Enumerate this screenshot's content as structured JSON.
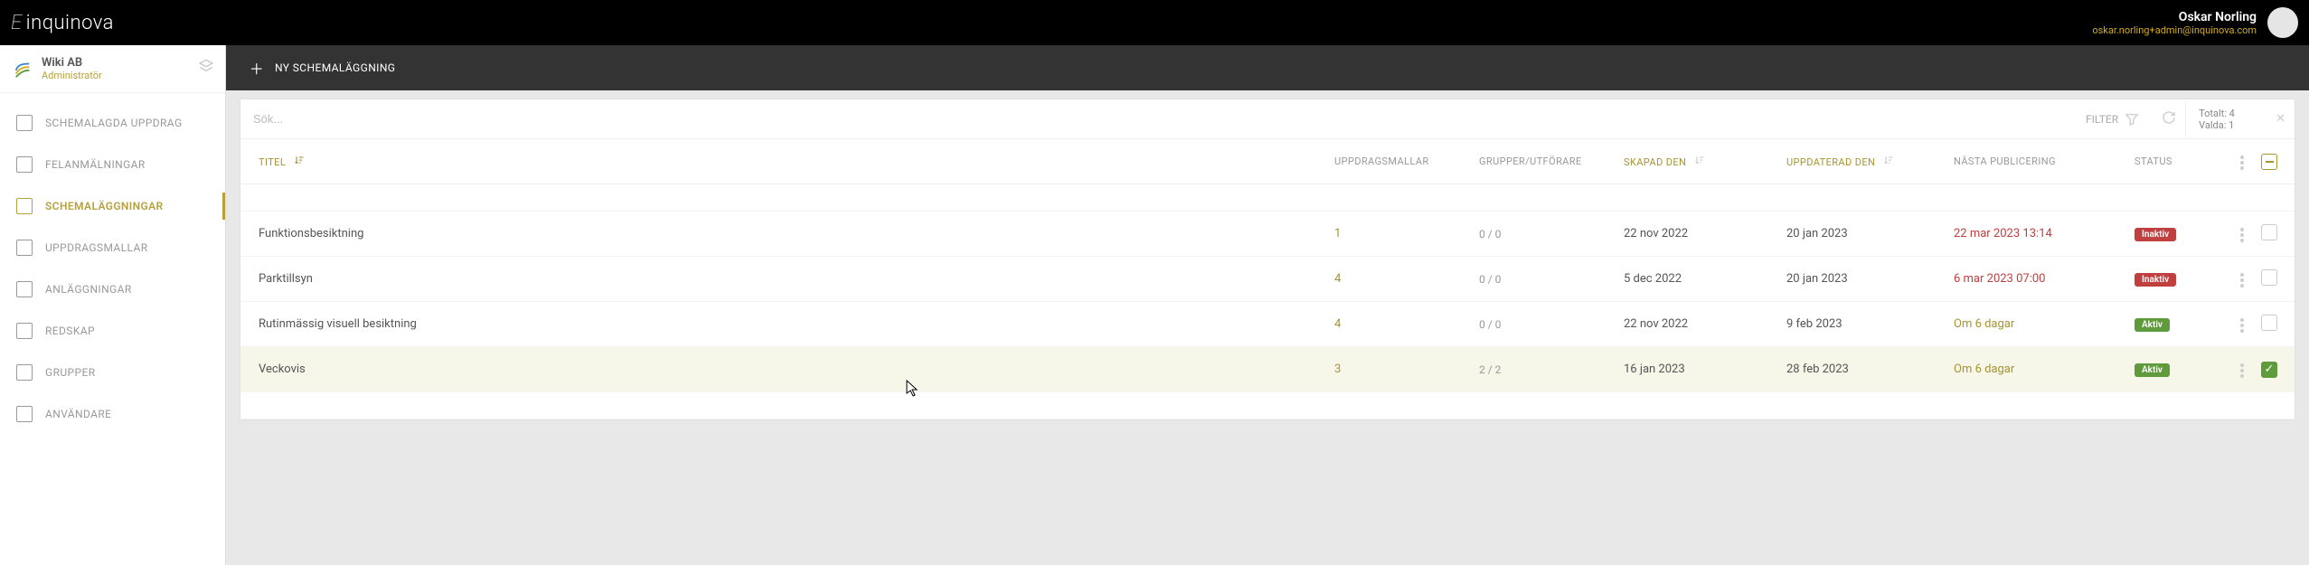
{
  "brand": {
    "prefix": "E",
    "name": "inquinova"
  },
  "user": {
    "name": "Oskar Norling",
    "email": "oskar.norling+admin@inquinova.com"
  },
  "org": {
    "name": "Wiki AB",
    "role": "Administratör"
  },
  "nav": {
    "items": [
      {
        "label": "SCHEMALAGDA UPPDRAG"
      },
      {
        "label": "FELANMÄLNINGAR"
      },
      {
        "label": "SCHEMALÄGGNINGAR"
      },
      {
        "label": "UPPDRAGSMALLAR"
      },
      {
        "label": "ANLÄGGNINGAR"
      },
      {
        "label": "REDSKAP"
      },
      {
        "label": "GRUPPER"
      },
      {
        "label": "ANVÄNDARE"
      }
    ],
    "activeIndex": 2
  },
  "action": {
    "new_label": "NY SCHEMALÄGGNING"
  },
  "search": {
    "placeholder": "Sök..."
  },
  "filter": {
    "label": "FILTER"
  },
  "counts": {
    "total_label": "Totalt:",
    "total_value": "4",
    "selected_label": "Valda:",
    "selected_value": "1"
  },
  "columns": {
    "title": "TITEL",
    "templates": "UPPDRAGSMALLAR",
    "groups": "GRUPPER/UTFÖRARE",
    "created": "SKAPAD DEN",
    "updated": "UPPDATERAD DEN",
    "next": "NÄSTA PUBLICERING",
    "status": "STATUS"
  },
  "rows": [
    {
      "title": "Funktionsbesiktning",
      "tpl": "1",
      "grp": "0 / 0",
      "created": "22 nov 2022",
      "updated": "20 jan 2023",
      "next": "22 mar 2023 13:14",
      "next_kind": "red",
      "status": "Inaktiv",
      "status_kind": "red",
      "checked": false
    },
    {
      "title": "Parktillsyn",
      "tpl": "4",
      "grp": "0 / 0",
      "created": "5 dec 2022",
      "updated": "20 jan 2023",
      "next": "6 mar 2023 07:00",
      "next_kind": "red",
      "status": "Inaktiv",
      "status_kind": "red",
      "checked": false
    },
    {
      "title": "Rutinmässig visuell besiktning",
      "tpl": "4",
      "grp": "0 / 0",
      "created": "22 nov 2022",
      "updated": "9 feb 2023",
      "next": "Om 6 dagar",
      "next_kind": "om",
      "status": "Aktiv",
      "status_kind": "green",
      "checked": false
    },
    {
      "title": "Veckovis",
      "tpl": "3",
      "grp": "2 / 2",
      "created": "16 jan 2023",
      "updated": "28 feb 2023",
      "next": "Om 6 dagar",
      "next_kind": "om",
      "status": "Aktiv",
      "status_kind": "green",
      "checked": true
    }
  ]
}
